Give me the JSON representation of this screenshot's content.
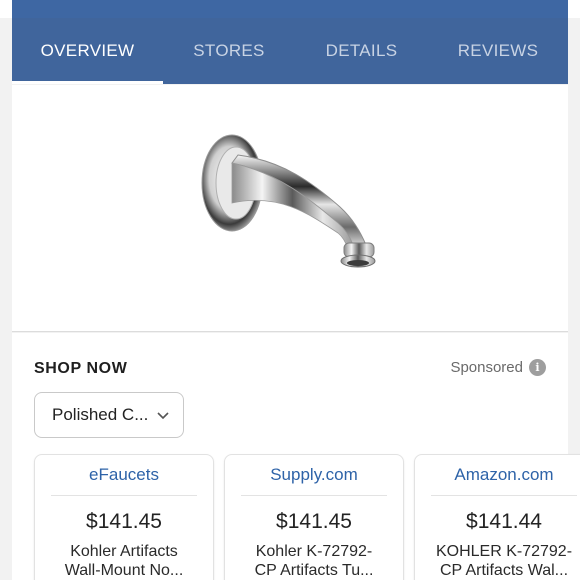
{
  "tabs": [
    {
      "label": "OVERVIEW",
      "active": true
    },
    {
      "label": "STORES",
      "active": false
    },
    {
      "label": "DETAILS",
      "active": false
    },
    {
      "label": "REVIEWS",
      "active": false
    }
  ],
  "product": {
    "image_icon": "faucet-spout-image"
  },
  "shop": {
    "title": "SHOP NOW",
    "sponsored_label": "Sponsored",
    "info_glyph": "i",
    "variant_selected": "Polished C...",
    "stores": [
      {
        "name": "eFaucets",
        "price": "$141.45",
        "desc_line1": "Kohler Artifacts",
        "desc_line2": "Wall-Mount No..."
      },
      {
        "name": "Supply.com",
        "price": "$141.45",
        "desc_line1": "Kohler K-72792-",
        "desc_line2": "CP Artifacts Tu..."
      },
      {
        "name": "Amazon.com",
        "price": "$141.44",
        "desc_line1": "KOHLER K-72792-",
        "desc_line2": "CP Artifacts Wal..."
      }
    ]
  },
  "colors": {
    "header_blue": "#40659c",
    "link_blue": "#2e63a8"
  }
}
